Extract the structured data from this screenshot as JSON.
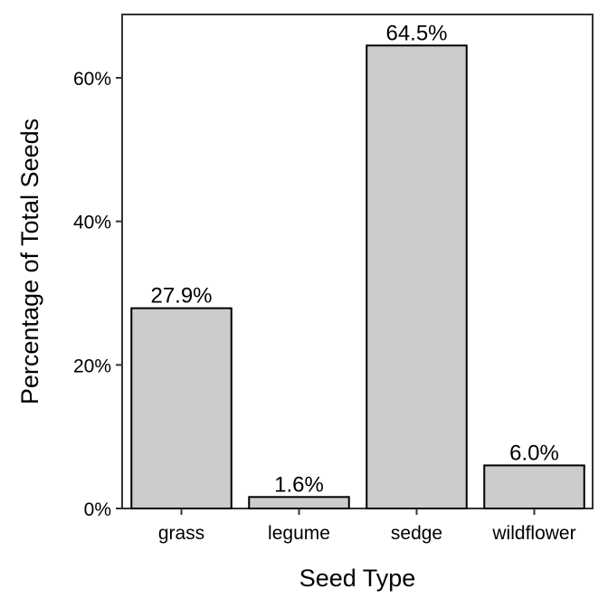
{
  "chart_data": {
    "type": "bar",
    "title": "",
    "xlabel": "Seed Type",
    "ylabel": "Percentage of Total Seeds",
    "categories": [
      "grass",
      "legume",
      "sedge",
      "wildflower"
    ],
    "values": [
      27.9,
      1.6,
      64.5,
      6.0
    ],
    "data_labels": [
      "27.9%",
      "1.6%",
      "64.5%",
      "6.0%"
    ],
    "ylim": [
      0,
      68.9
    ],
    "yticks": [
      0,
      20,
      40,
      60
    ],
    "ytick_labels": [
      "0%",
      "20%",
      "40%",
      "60%"
    ],
    "grid": false,
    "legend": "none",
    "bar_fill": "#cccccc",
    "bar_stroke": "#000000"
  }
}
